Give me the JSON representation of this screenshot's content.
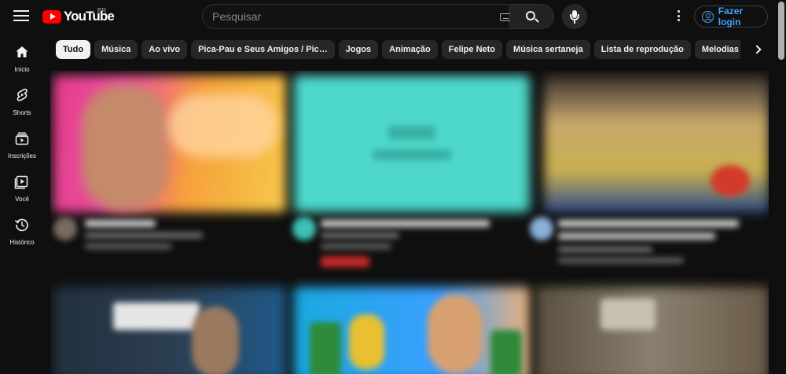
{
  "masthead": {
    "logo_text": "YouTube",
    "country_code": "BR",
    "search": {
      "placeholder": "Pesquisar"
    },
    "login_label": "Fazer login"
  },
  "guide": {
    "items": [
      {
        "label": "Início",
        "icon": "home-icon"
      },
      {
        "label": "Shorts",
        "icon": "shorts-icon"
      },
      {
        "label": "Inscrições",
        "icon": "subscriptions-icon"
      },
      {
        "label": "Você",
        "icon": "you-icon"
      },
      {
        "label": "Histórico",
        "icon": "history-icon"
      }
    ]
  },
  "chips": [
    {
      "label": "Tudo",
      "active": true
    },
    {
      "label": "Música"
    },
    {
      "label": "Ao vivo"
    },
    {
      "label": "Pica-Pau e Seus Amigos / Pic…"
    },
    {
      "label": "Jogos"
    },
    {
      "label": "Animação"
    },
    {
      "label": "Felipe Neto"
    },
    {
      "label": "Música sertaneja"
    },
    {
      "label": "Lista de reprodução"
    },
    {
      "label": "Melodias"
    }
  ],
  "colors": {
    "background": "#0f0f0f",
    "brand_red": "#ff0000",
    "login_blue": "#3ea6ff",
    "chip_bg": "#272727",
    "chip_active_bg": "#f1f1f1"
  }
}
